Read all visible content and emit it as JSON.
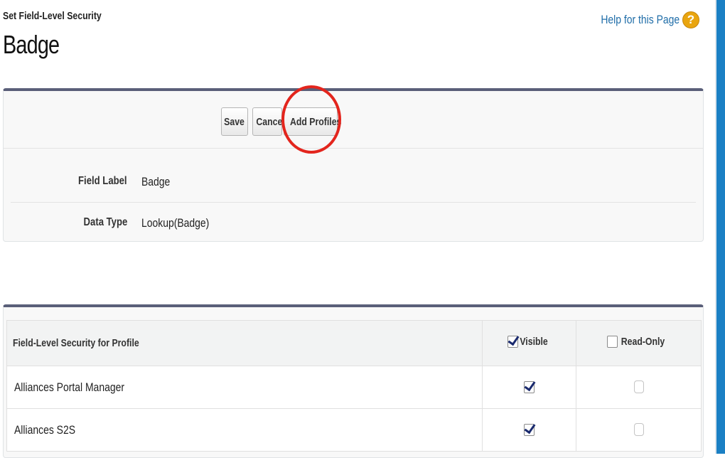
{
  "header": {
    "subtitle": "Set Field-Level Security",
    "title": "Badge",
    "help_label": "Help for this Page",
    "help_icon": "question-icon"
  },
  "buttons": {
    "save": "Save",
    "cancel": "Cancel",
    "add_profiles": "Add Profiles"
  },
  "details": [
    {
      "label": "Field Label",
      "value": "Badge"
    },
    {
      "label": "Data Type",
      "value": "Lookup(Badge)"
    }
  ],
  "table": {
    "columns": {
      "profile": "Field-Level Security for Profile",
      "visible": "Visible",
      "read_only": "Read-Only"
    },
    "header_checks": {
      "visible": true,
      "read_only": false
    },
    "rows": [
      {
        "profile": "Alliances Portal Manager",
        "visible": true,
        "read_only": false
      },
      {
        "profile": "Alliances S2S",
        "visible": true,
        "read_only": false
      }
    ]
  },
  "colors": {
    "accent": "#5a5f79",
    "link": "#1f6da8",
    "highlight_circle": "#e3251d",
    "help_icon": "#e9a50f",
    "right_bar": "#1b80c4"
  }
}
